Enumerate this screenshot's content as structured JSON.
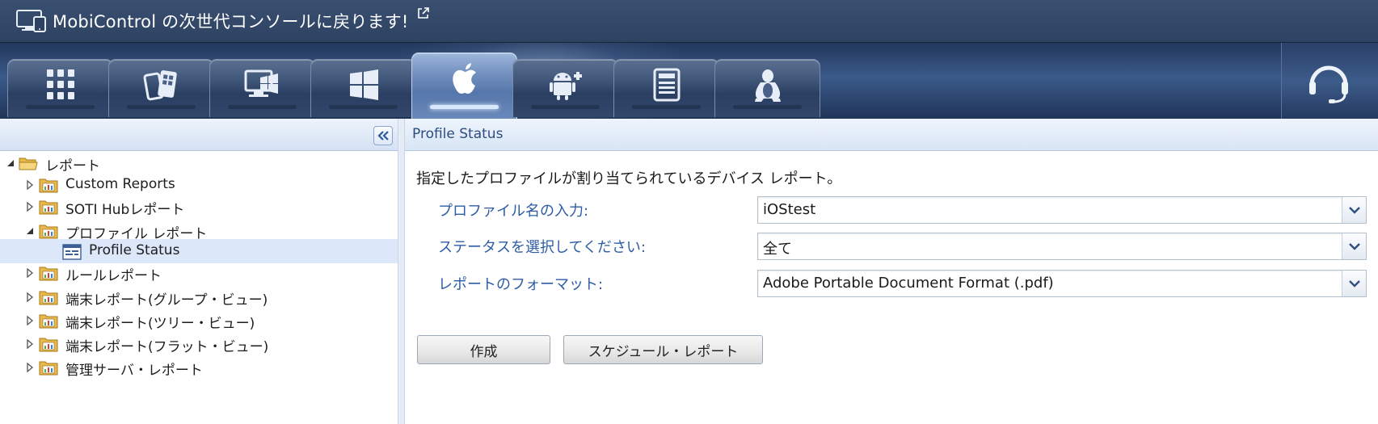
{
  "header": {
    "back_link_text": "MobiControl の次世代コンソールに戻ります!",
    "monitor_icon": "monitor-devices-icon",
    "external_icon": "external-link-icon"
  },
  "tabs": [
    {
      "name": "all-devices",
      "icon": "grid-icon",
      "active": false
    },
    {
      "name": "windows-mobile",
      "icon": "windows-mobile-icon",
      "active": false
    },
    {
      "name": "windows-desktop-classic",
      "icon": "windows-classic-icon",
      "active": false
    },
    {
      "name": "windows-modern",
      "icon": "windows-modern-icon",
      "active": false
    },
    {
      "name": "apple",
      "icon": "apple-icon",
      "active": true
    },
    {
      "name": "android-plus",
      "icon": "android-plus-icon",
      "active": false
    },
    {
      "name": "printer",
      "icon": "printer-icon",
      "active": false
    },
    {
      "name": "linux",
      "icon": "linux-tux-icon",
      "active": false
    }
  ],
  "support_icon": "headset-icon",
  "left_panel": {
    "collapse_icon": "double-chevron-left-icon",
    "tree": {
      "root_label": "レポート",
      "items": [
        {
          "label": "Custom Reports",
          "expanded": false
        },
        {
          "label": "SOTI Hubレポート",
          "expanded": false
        },
        {
          "label": "プロファイル レポート",
          "expanded": true,
          "children": [
            {
              "label": "Profile Status",
              "selected": true
            }
          ]
        },
        {
          "label": "ルールレポート",
          "expanded": false
        },
        {
          "label": "端末レポート(グループ・ビュー)",
          "expanded": false
        },
        {
          "label": "端末レポート(ツリー・ビュー)",
          "expanded": false
        },
        {
          "label": "端末レポート(フラット・ビュー)",
          "expanded": false
        },
        {
          "label": "管理サーバ・レポート",
          "expanded": false
        }
      ]
    }
  },
  "main": {
    "title": "Profile Status",
    "description": "指定したプロファイルが割り当てられているデバイス レポート。",
    "fields": [
      {
        "label": "プロファイル名の入力:",
        "value": "iOStest"
      },
      {
        "label": "ステータスを選択してください:",
        "value": "全て"
      },
      {
        "label": "レポートのフォーマット:",
        "value": "Adobe Portable Document Format (.pdf)"
      }
    ],
    "buttons": {
      "create": "作成",
      "schedule": "スケジュール・レポート"
    }
  },
  "colors": {
    "header_bg": "#2e4262",
    "label_blue": "#2d5ca6",
    "selection_bg": "#dce8fa"
  }
}
